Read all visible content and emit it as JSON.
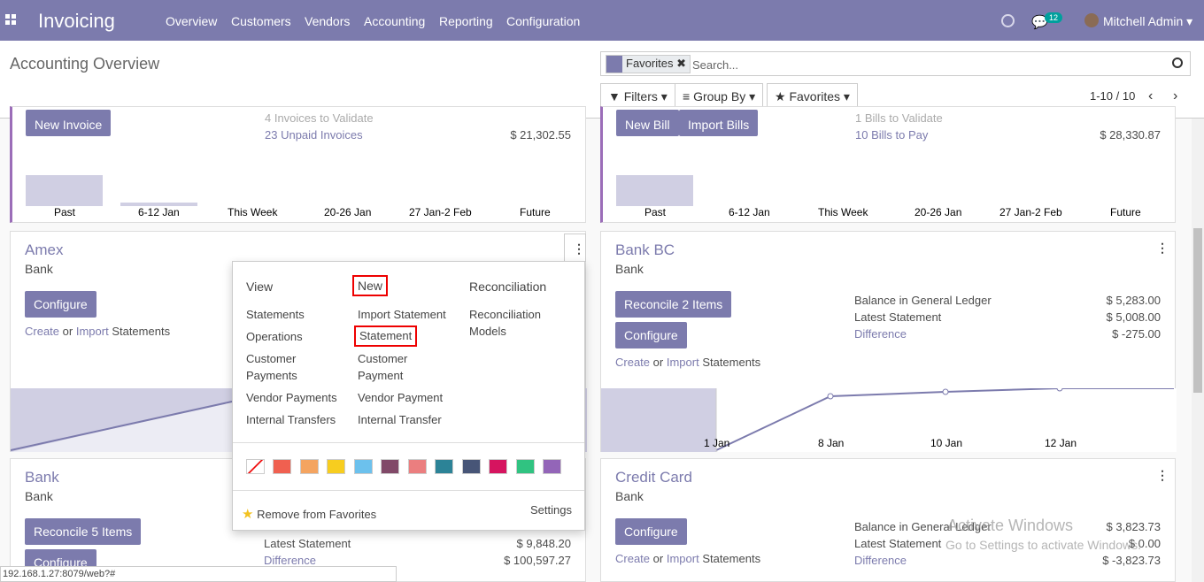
{
  "nav": {
    "brand": "Invoicing",
    "menus": [
      "Overview",
      "Customers",
      "Vendors",
      "Accounting",
      "Reporting",
      "Configuration"
    ],
    "badge": "12",
    "user": "Mitchell Admin"
  },
  "cp": {
    "title": "Accounting Overview",
    "facet": "Favorites",
    "search_placeholder": "Search...",
    "filters": "Filters",
    "groupby": "Group By",
    "favorites": "Favorites",
    "pager": "1-10 / 10"
  },
  "sales": {
    "btn": "New Invoice",
    "link1": "4 Invoices to Validate",
    "link2": "23 Unpaid Invoices",
    "amt2": "$ 21,302.55",
    "x": [
      "Past",
      "6-12 Jan",
      "This Week",
      "20-26 Jan",
      "27 Jan-2 Feb",
      "Future"
    ]
  },
  "purch": {
    "btn1": "New Bill",
    "btn2": "Import Bills",
    "link1": "1 Bills to Validate",
    "link2": "10 Bills to Pay",
    "amt2": "$ 28,330.87",
    "x": [
      "Past",
      "6-12 Jan",
      "This Week",
      "20-26 Jan",
      "27 Jan-2 Feb",
      "Future"
    ]
  },
  "amex": {
    "title": "Amex",
    "sub": "Bank",
    "btn": "Configure",
    "create": "Create",
    "or": "or",
    "imp": "Import",
    "stmts": "Statements"
  },
  "bankbc": {
    "title": "Bank BC",
    "sub": "Bank",
    "btn1": "Reconcile 2 Items",
    "btn2": "Configure",
    "create": "Create",
    "or": "or",
    "imp": "Import",
    "stmts": "Statements",
    "l1": "Balance in General Ledger",
    "a1": "$ 5,283.00",
    "l2": "Latest Statement",
    "a2": "$ 5,008.00",
    "l3": "Difference",
    "a3": "$ -275.00",
    "x": [
      "1 Jan",
      "8 Jan",
      "10 Jan",
      "12 Jan"
    ]
  },
  "bank": {
    "title": "Bank",
    "sub": "Bank",
    "btn1": "Reconcile 5 Items",
    "btn2": "Configure",
    "l2": "Latest Statement",
    "a2": "$ 9,848.20",
    "l3": "Difference",
    "a3": "$ 100,597.27"
  },
  "cc": {
    "title": "Credit Card",
    "sub": "Bank",
    "btn": "Configure",
    "create": "Create",
    "or": "or",
    "imp": "Import",
    "stmts": "Statements",
    "l1": "Balance in General Ledger",
    "a1": "$ 3,823.73",
    "l2": "Latest Statement",
    "a2": "$ 0.00",
    "l3": "Difference",
    "a3": "$ -3,823.73"
  },
  "dd": {
    "h1": "View",
    "h2": "New",
    "h3": "Reconciliation",
    "v1": "Statements",
    "v2": "Operations",
    "v3": "Customer Payments",
    "v4": "Vendor Payments",
    "v5": "Internal Transfers",
    "n1": "Import Statement",
    "n2": "Statement",
    "n3": "Customer Payment",
    "n4": "Vendor Payment",
    "n5": "Internal Transfer",
    "r1": "Reconciliation Models",
    "remove": "Remove from Favorites",
    "settings": "Settings",
    "colors": [
      "#f06050",
      "#f4a460",
      "#f7cd1f",
      "#6cc1ed",
      "#814968",
      "#eb7e7f",
      "#2c8397",
      "#475577",
      "#d6145f",
      "#30c381",
      "#9365b8"
    ]
  },
  "status": "192.168.1.27:8079/web?#",
  "wm": {
    "t1": "Activate Windows",
    "t2": "Go to Settings to activate Windows."
  }
}
